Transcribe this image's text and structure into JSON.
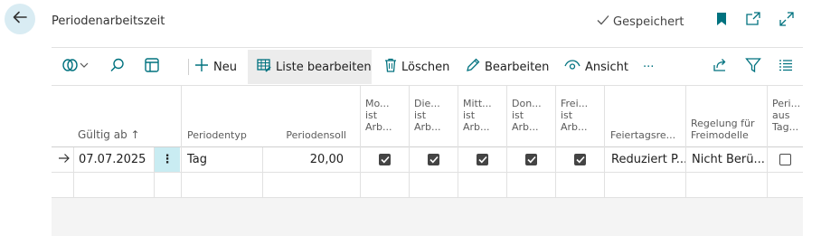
{
  "page": {
    "title": "Periodenarbeitszeit",
    "saved_label": "Gespeichert"
  },
  "header_icons": [
    "back-arrow-icon",
    "bookmark-icon",
    "open-new-window-icon",
    "expand-icon"
  ],
  "toolbar": {
    "new_label": "Neu",
    "edit_list_label": "Liste bearbeiten",
    "delete_label": "Löschen",
    "edit_label": "Bearbeiten",
    "view_label": "Ansicht",
    "more_label": "···"
  },
  "columns": {
    "valid_from": "Gültig ab",
    "valid_from_sort": "↑",
    "period_type": "Periodentyp",
    "period_target": "Periodensoll",
    "mo": [
      "Mo...",
      "ist",
      "Arb..."
    ],
    "di": [
      "Die...",
      "ist",
      "Arb..."
    ],
    "mi": [
      "Mitt...",
      "ist",
      "Arb..."
    ],
    "do": [
      "Don...",
      "ist",
      "Arb..."
    ],
    "fr": [
      "Frei...",
      "ist",
      "Arb..."
    ],
    "holiday_rule": "Feiertagsre...",
    "free_rule": [
      "Regelung für",
      "Freimodelle"
    ],
    "period_from_days": [
      "Peri...",
      "aus",
      "Tag..."
    ]
  },
  "rows": [
    {
      "valid_from": "07.07.2025",
      "period_type": "Tag",
      "period_target": "20,00",
      "mo": true,
      "di": true,
      "mi": true,
      "do": true,
      "fr": true,
      "holiday_rule": "Reduziert P...",
      "free_rule": "Nicht Berü...",
      "period_from_days": false
    }
  ],
  "colors": {
    "accent": "#00727f",
    "back_bg": "#d9ecf3",
    "row_menu_bg": "#c9ecf2"
  }
}
